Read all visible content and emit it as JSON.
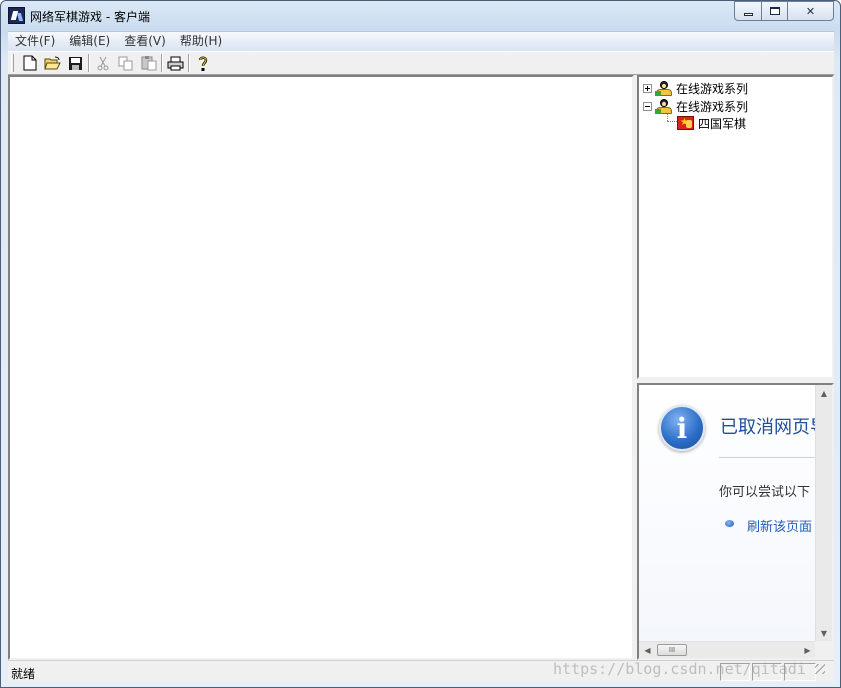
{
  "window": {
    "title": "网络军棋游戏 - 客户端",
    "min_glyph": "",
    "max_glyph": "",
    "close_glyph": "✕"
  },
  "menu": {
    "items": [
      "文件(F)",
      "编辑(E)",
      "查看(V)",
      "帮助(H)"
    ]
  },
  "toolbar": {
    "buttons": [
      "new-file-icon",
      "open-folder-icon",
      "save-icon",
      "cut-icon",
      "copy-icon",
      "paste-icon",
      "print-icon",
      "help-icon"
    ]
  },
  "tree": {
    "nodes": [
      {
        "label": "在线游戏系列",
        "expanded": false
      },
      {
        "label": "在线游戏系列",
        "expanded": true,
        "children": [
          {
            "label": "四国军棋"
          }
        ]
      }
    ]
  },
  "browser": {
    "title": "已取消网页导",
    "suggest": "你可以尝试以下",
    "link": "刷新该页面",
    "hthumb_glyph": "III"
  },
  "status": {
    "text": "就绪"
  },
  "watermark": "https://blog.csdn.net/qitadi",
  "colors": {
    "link": "#1f5fbf",
    "title_blue": "#1f4e9c",
    "flag_red": "#d8221a"
  }
}
